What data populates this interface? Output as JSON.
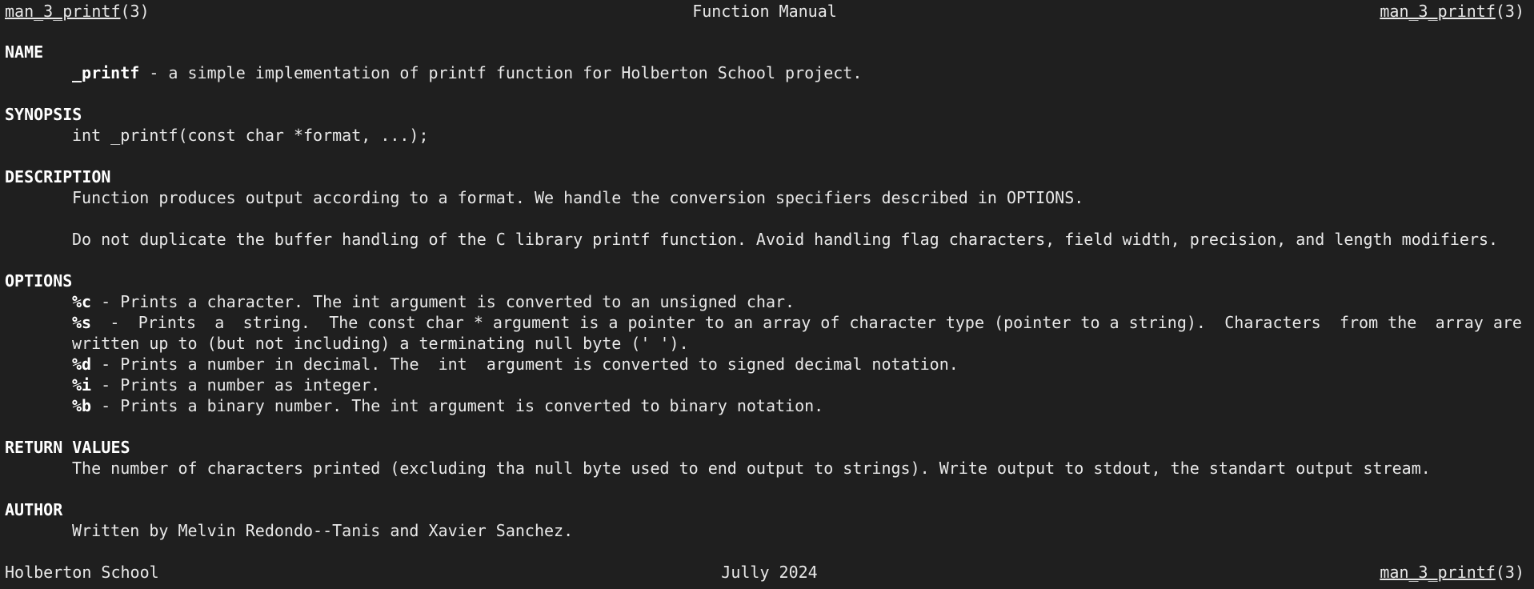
{
  "header": {
    "left": "man_3_printf",
    "left_suffix": "(3)",
    "center": "Function Manual",
    "right": "man_3_printf",
    "right_suffix": "(3)"
  },
  "name": {
    "heading": "NAME",
    "fn": "_printf",
    "desc": " - a simple implementation of printf function for Holberton School project."
  },
  "synopsis": {
    "heading": "SYNOPSIS",
    "text": "int _printf(const char *format, ...);"
  },
  "description": {
    "heading": "DESCRIPTION",
    "p1": "Function produces output according to a format. We handle the conversion specifiers described in OPTIONS.",
    "p2": "Do not duplicate the buffer handling of the C library printf function. Avoid handling flag characters, field width, precision, and length modifiers."
  },
  "options": {
    "heading": "OPTIONS",
    "c_flag": "%c",
    "c_text": " - Prints a character. The int argument is converted to an unsigned char.",
    "s_flag": "%s",
    "s_parts": [
      "-",
      "Prints",
      "a",
      "string.",
      "The const char * argument is a pointer to an array of character type (pointer to a string).",
      "Characters",
      "from the",
      "array are"
    ],
    "s_line2": "written up to (but not including) a terminating null byte (' ').",
    "d_flag": "%d",
    "d_text": " - Prints a number in decimal. The  int  argument is converted to signed decimal notation.",
    "i_flag": "%i",
    "i_text": " - Prints a number as integer.",
    "b_flag": "%b",
    "b_text": " - Prints a binary number. The int argument is converted to binary notation."
  },
  "return_values": {
    "heading": "RETURN VALUES",
    "text": "The number of characters printed (excluding tha null byte used to end output to strings). Write output to stdout, the standart output stream."
  },
  "author": {
    "heading": "AUTHOR",
    "text": "Written by Melvin Redondo--Tanis and Xavier Sanchez."
  },
  "footer": {
    "left": "Holberton School",
    "center": "Jully 2024",
    "right": "man_3_printf",
    "right_suffix": "(3)"
  }
}
